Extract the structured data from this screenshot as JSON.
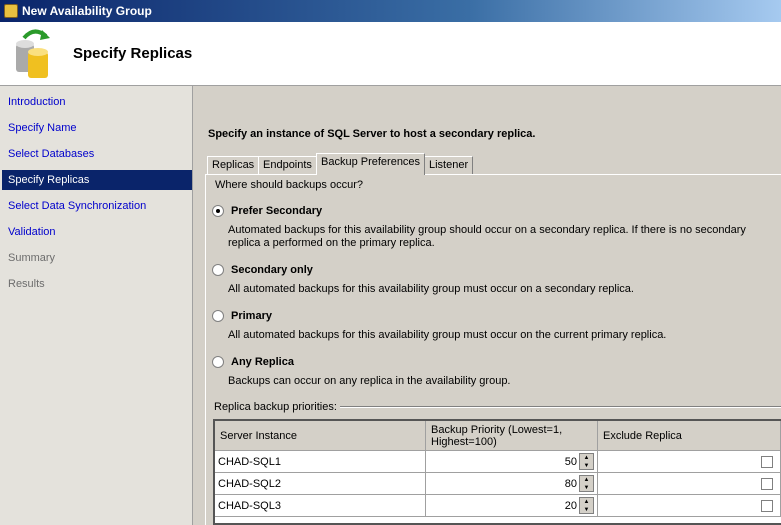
{
  "window": {
    "title": "New Availability Group"
  },
  "header": {
    "title": "Specify Replicas"
  },
  "nav": [
    {
      "label": "Introduction",
      "state": "link"
    },
    {
      "label": "Specify Name",
      "state": "link"
    },
    {
      "label": "Select Databases",
      "state": "link"
    },
    {
      "label": "Specify Replicas",
      "state": "selected"
    },
    {
      "label": "Select Data Synchronization",
      "state": "link"
    },
    {
      "label": "Validation",
      "state": "link"
    },
    {
      "label": "Summary",
      "state": "disabled"
    },
    {
      "label": "Results",
      "state": "disabled"
    }
  ],
  "main": {
    "instruction": "Specify an instance of SQL Server to host a secondary replica.",
    "tabs": [
      "Replicas",
      "Endpoints",
      "Backup Preferences",
      "Listener"
    ],
    "active_tab": "Backup Preferences",
    "question": "Where should backups occur?",
    "options": [
      {
        "label": "Prefer Secondary",
        "selected": true,
        "desc1": "Automated backups for this availability group should occur on a secondary replica. If there is no secondary replica a",
        "desc2": "performed on the primary replica."
      },
      {
        "label": "Secondary only",
        "selected": false,
        "desc1": "All automated backups for this availability group must occur on a secondary replica."
      },
      {
        "label": "Primary",
        "selected": false,
        "desc1": "All automated backups for this availability group must occur on the current primary replica."
      },
      {
        "label": "Any Replica",
        "selected": false,
        "desc1": "Backups can occur on any replica in the availability group."
      }
    ],
    "priorities_label": "Replica backup priorities:",
    "columns": [
      "Server Instance",
      "Backup Priority (Lowest=1, Highest=100)",
      "Exclude Replica"
    ],
    "rows": [
      {
        "server": "CHAD-SQL1",
        "priority": "50",
        "exclude": false
      },
      {
        "server": "CHAD-SQL2",
        "priority": "80",
        "exclude": false
      },
      {
        "server": "CHAD-SQL3",
        "priority": "20",
        "exclude": false
      }
    ]
  }
}
